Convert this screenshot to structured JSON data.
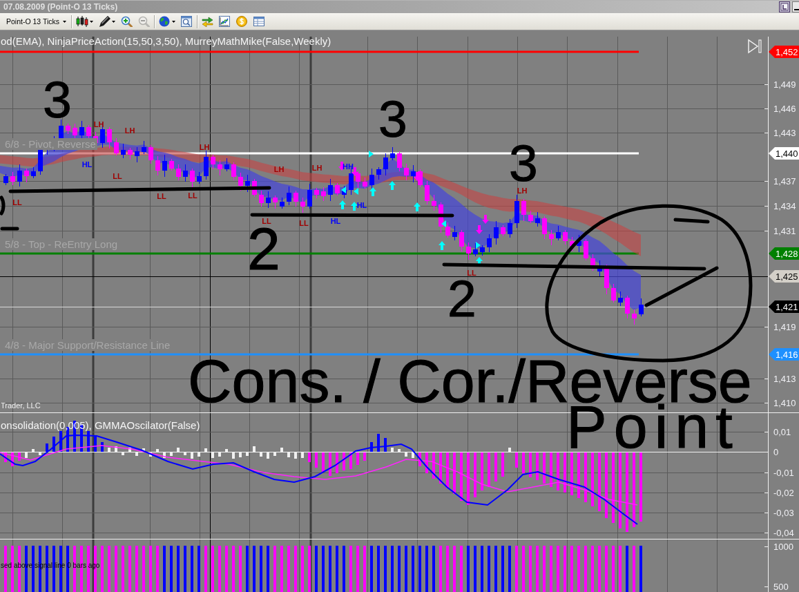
{
  "window": {
    "title": "07.08.2009 (Point-O 13 Ticks)"
  },
  "toolbar": {
    "instrument": "Point-O 13 Ticks",
    "groups": [
      [
        {
          "kind": "candlesticks",
          "dropdown": true,
          "disabled": false
        },
        {
          "kind": "pen",
          "dropdown": true,
          "disabled": false
        },
        {
          "kind": "zoom-in",
          "dropdown": false,
          "disabled": false
        },
        {
          "kind": "zoom-out",
          "dropdown": false,
          "disabled": true
        }
      ],
      [
        {
          "kind": "globe",
          "dropdown": true,
          "disabled": false
        },
        {
          "kind": "chart-view",
          "dropdown": false,
          "disabled": false
        }
      ],
      [
        {
          "kind": "exchange",
          "dropdown": false,
          "disabled": false
        },
        {
          "kind": "line-chart",
          "dropdown": false,
          "disabled": false
        },
        {
          "kind": "coin",
          "dropdown": false,
          "disabled": false
        },
        {
          "kind": "table",
          "dropdown": false,
          "disabled": false
        }
      ]
    ]
  },
  "price_panel": {
    "indicators": "od(EMA), NinjaPriceAction(15,50,3,50), MurreyMathMike(False,Weekly)",
    "axis": [
      {
        "value": "1,452",
        "kind": "level",
        "color": "#ff0000"
      },
      {
        "value": "1,449",
        "kind": "tick"
      },
      {
        "value": "1,446",
        "kind": "tick"
      },
      {
        "value": "1,443",
        "kind": "tick"
      },
      {
        "value": "1,440",
        "kind": "level",
        "color": "#ffffff",
        "label": "6/8 - Pivot, Reverse"
      },
      {
        "value": "1,437",
        "kind": "tick"
      },
      {
        "value": "1,434",
        "kind": "tick"
      },
      {
        "value": "1,431",
        "kind": "tick"
      },
      {
        "value": "1,428",
        "kind": "level",
        "color": "#008000",
        "label": "5/8 - Top - ReEntry Long"
      },
      {
        "value": "1,425",
        "kind": "price",
        "color": "#d4d0c8"
      },
      {
        "value": "1,421",
        "kind": "price",
        "color": "#000000"
      },
      {
        "value": "1,419",
        "kind": "tick"
      },
      {
        "value": "1,416",
        "kind": "level",
        "color": "#1e90ff",
        "label": "4/8 - Major Support/Resistance Line"
      },
      {
        "value": "1,413",
        "kind": "tick"
      },
      {
        "value": "1,410",
        "kind": "tick"
      }
    ],
    "swing_labels": [
      {
        "text": "LL",
        "color": "#a00000"
      },
      {
        "text": "HL",
        "color": "#0000ff"
      },
      {
        "text": "LH",
        "color": "#a00000"
      },
      {
        "text": "LL",
        "color": "#a00000"
      },
      {
        "text": "LH",
        "color": "#a00000"
      },
      {
        "text": "LL",
        "color": "#a00000"
      },
      {
        "text": "LL",
        "color": "#a00000"
      },
      {
        "text": "LH",
        "color": "#a00000"
      },
      {
        "text": "LL",
        "color": "#a00000"
      },
      {
        "text": "LH",
        "color": "#a00000"
      },
      {
        "text": "LL",
        "color": "#a00000"
      },
      {
        "text": "LH",
        "color": "#a00000"
      },
      {
        "text": "HL",
        "color": "#0000ff"
      },
      {
        "text": "HH",
        "color": "#0000ff"
      },
      {
        "text": "HL",
        "color": "#0000ff"
      },
      {
        "text": "LL",
        "color": "#a00000"
      },
      {
        "text": "LH",
        "color": "#a00000"
      }
    ],
    "copyright": "Trader, LLC"
  },
  "oscillator_panel": {
    "indicators": "onsolidation(0,005), GMMAOscilator(False)",
    "axis": [
      "0,01",
      "0",
      "-0,01",
      "-0,02",
      "-0,03",
      "-0,04"
    ]
  },
  "signal_panel": {
    "status": "sed above signal line 0 bars ago",
    "axis": [
      "1000",
      "500"
    ]
  },
  "annotations": [
    {
      "text": "3"
    },
    {
      "text": "3"
    },
    {
      "text": "3"
    },
    {
      "text": "2"
    },
    {
      "text": "2"
    },
    {
      "text": "Cons. / Cor./Reverse"
    },
    {
      "text": "Point"
    }
  ]
}
